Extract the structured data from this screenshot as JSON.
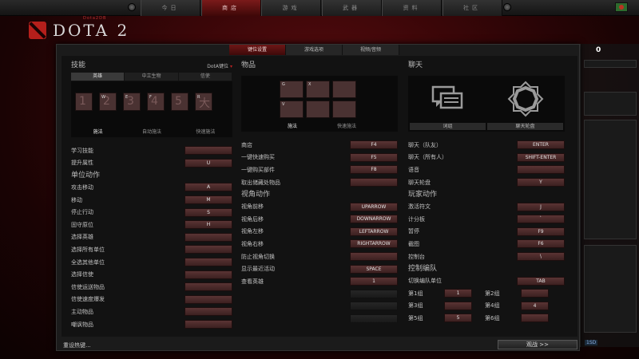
{
  "nav": {
    "tabs": [
      "今日",
      "商店",
      "游戏",
      "武器",
      "资料",
      "社区"
    ],
    "active_index": 1
  },
  "logo": {
    "small_text": "Dota2DB",
    "text": "DOTA 2"
  },
  "side": {
    "count": "0"
  },
  "dialog": {
    "tabs": [
      "键位设置",
      "游戏选项",
      "视频/音频"
    ],
    "active_tab_index": 0,
    "skills": {
      "title": "技能",
      "preset_label": "DotA键位",
      "subtabs": [
        "英雄",
        "中立生物",
        "信使"
      ],
      "slots": [
        {
          "key": "",
          "num": "1"
        },
        {
          "key": "W",
          "num": "2"
        },
        {
          "key": "E",
          "num": "3"
        },
        {
          "key": "F",
          "num": "4"
        },
        {
          "key": "",
          "num": "5"
        },
        {
          "key": "R",
          "num": "大"
        }
      ],
      "cast_modes": [
        "施法",
        "自动施法",
        "快速施法"
      ],
      "rows": [
        {
          "label": "学习技能",
          "key": ""
        },
        {
          "label": "提升属性",
          "key": "U"
        }
      ]
    },
    "unit_actions": {
      "title": "单位动作",
      "rows": [
        {
          "label": "攻击移动",
          "key": "A"
        },
        {
          "label": "移动",
          "key": "M"
        },
        {
          "label": "停止行动",
          "key": "S"
        },
        {
          "label": "固守原位",
          "key": "H"
        },
        {
          "label": "选择英雄",
          "key": ""
        },
        {
          "label": "选择所有单位",
          "key": ""
        },
        {
          "label": "全选其他单位",
          "key": ""
        },
        {
          "label": "选择信使",
          "key": ""
        },
        {
          "label": "信使运送物品",
          "key": ""
        },
        {
          "label": "信使速度爆发",
          "key": ""
        },
        {
          "label": "主动物品",
          "key": ""
        },
        {
          "label": "嘲讽物品",
          "key": ""
        }
      ]
    },
    "items": {
      "title": "物品",
      "slots": [
        "G",
        "X",
        "",
        "V",
        "",
        ""
      ],
      "cast_modes": [
        "施法",
        "快速施法"
      ],
      "rows": [
        {
          "label": "商店",
          "key": "F4"
        },
        {
          "label": "一键快速购买",
          "key": "F5"
        },
        {
          "label": "一键购买部件",
          "key": "F8"
        },
        {
          "label": "取出储藏处物品",
          "key": ""
        }
      ]
    },
    "camera": {
      "title": "视角动作",
      "rows": [
        {
          "label": "视角前移",
          "key": "UPARROW"
        },
        {
          "label": "视角后移",
          "key": "DOWNARROW"
        },
        {
          "label": "视角左移",
          "key": "LEFTARROW"
        },
        {
          "label": "视角右移",
          "key": "RIGHTARROW"
        },
        {
          "label": "防止视角切换",
          "key": ""
        },
        {
          "label": "显示最近活动",
          "key": "SPACE"
        },
        {
          "label": "查看英雄",
          "key": "1"
        }
      ]
    },
    "chat": {
      "title": "聊天",
      "buttons": [
        "词组",
        "聊天轮盘"
      ],
      "rows": [
        {
          "label": "聊天（队友）",
          "key": "ENTER"
        },
        {
          "label": "聊天（所有人）",
          "key": "SHIFT-ENTER"
        },
        {
          "label": "语音",
          "key": ""
        },
        {
          "label": "聊天轮盘",
          "key": "Y"
        }
      ]
    },
    "player_actions": {
      "title": "玩家动作",
      "rows": [
        {
          "label": "激活符文",
          "key": "J"
        },
        {
          "label": "计分板",
          "key": "`"
        },
        {
          "label": "暂停",
          "key": "F9"
        },
        {
          "label": "截图",
          "key": "F6"
        },
        {
          "label": "控制台",
          "key": "\\"
        }
      ]
    },
    "control_groups": {
      "title": "控制编队",
      "switch_label": "切换编队单位",
      "switch_key": "TAB",
      "groups": [
        {
          "label": "第1组",
          "key": "1"
        },
        {
          "label": "第2组",
          "key": ""
        },
        {
          "label": "第3组",
          "key": ""
        },
        {
          "label": "第4组",
          "key": "4"
        },
        {
          "label": "第5组",
          "key": "5"
        },
        {
          "label": "第6组",
          "key": ""
        }
      ]
    },
    "reset_label": "重设热键...",
    "spectate_label": "观战 >>"
  },
  "colors": {
    "accent": "#6d1616",
    "key_box": "#4a2a2a",
    "panel": "#121212"
  },
  "bottom_badge": "1SD"
}
